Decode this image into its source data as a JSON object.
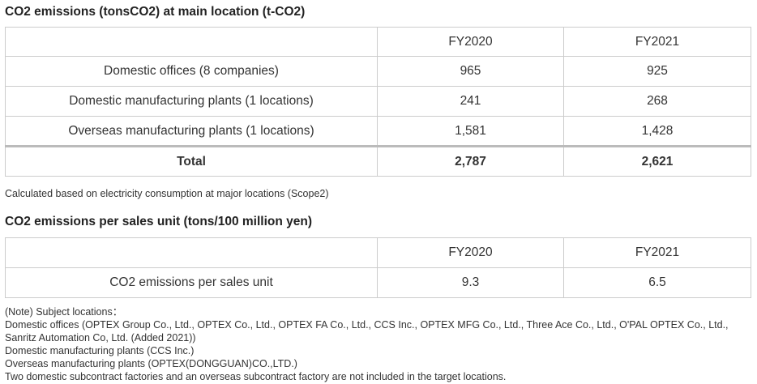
{
  "section1": {
    "heading": "CO2 emissions (tonsCO2) at main location (t-CO2)",
    "col_headers": [
      "",
      "FY2020",
      "FY2021"
    ],
    "rows": [
      {
        "label": "Domestic offices (8 companies)",
        "fy2020": "965",
        "fy2021": "925"
      },
      {
        "label": "Domestic manufacturing plants (1 locations)",
        "fy2020": "241",
        "fy2021": "268"
      },
      {
        "label": "Overseas manufacturing plants (1 locations)",
        "fy2020": "1,581",
        "fy2021": "1,428"
      }
    ],
    "total": {
      "label": "Total",
      "fy2020": "2,787",
      "fy2021": "2,621"
    },
    "footnote": "Calculated based on electricity consumption at major locations (Scope2)"
  },
  "section2": {
    "heading": "CO2 emissions per sales unit (tons/100 million yen)",
    "col_headers": [
      "",
      "FY2020",
      "FY2021"
    ],
    "rows": [
      {
        "label": "CO2 emissions per sales unit",
        "fy2020": "9.3",
        "fy2021": "6.5"
      }
    ]
  },
  "notes": {
    "title": "(Note) Subject locations：",
    "lines": [
      "Domestic offices (OPTEX Group Co., Ltd., OPTEX Co., Ltd., OPTEX FA Co., Ltd., CCS Inc., OPTEX MFG Co., Ltd., Three Ace Co., Ltd., O'PAL OPTEX Co., Ltd., Sanritz Automation Co, Ltd. (Added 2021))",
      "Domestic manufacturing plants (CCS Inc.)",
      "Overseas manufacturing plants (OPTEX(DONGGUAN)CO.,LTD.)",
      "Two domestic subcontract factories and an overseas subcontract factory are not included in the target locations."
    ]
  }
}
